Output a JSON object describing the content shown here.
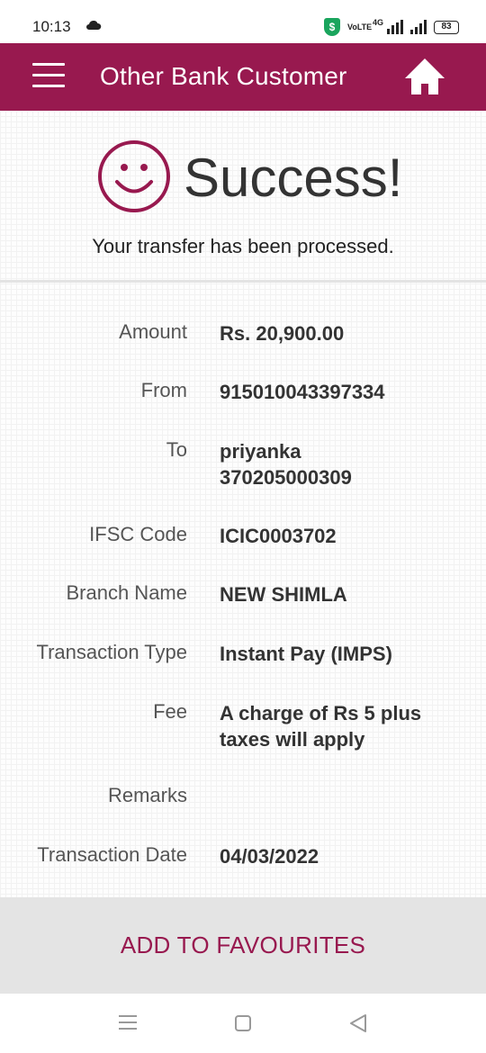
{
  "status_bar": {
    "time": "10:13",
    "volte": "VoLTE",
    "network": "4G",
    "battery": "83"
  },
  "app_bar": {
    "title": "Other Bank Customer",
    "menu_icon": "hamburger-icon",
    "home_icon": "home-icon"
  },
  "success": {
    "title": "Success!",
    "message": "Your transfer has been processed.",
    "icon": "smiley-icon"
  },
  "details": [
    {
      "label": "Amount",
      "value": "Rs. 20,900.00"
    },
    {
      "label": "From",
      "value": "915010043397334"
    },
    {
      "label": "To",
      "value": "priyanka\n370205000309"
    },
    {
      "label": "IFSC Code",
      "value": "ICIC0003702"
    },
    {
      "label": "Branch Name",
      "value": "NEW SHIMLA"
    },
    {
      "label": "Transaction Type",
      "value": "Instant Pay (IMPS)"
    },
    {
      "label": "Fee",
      "value": "A charge of Rs 5 plus taxes will apply"
    },
    {
      "label": "Remarks",
      "value": ""
    },
    {
      "label": "Transaction Date",
      "value": "04/03/2022"
    }
  ],
  "footer": {
    "button_label": "ADD TO FAVOURITES"
  },
  "colors": {
    "brand": "#98194f",
    "footer_bg": "#e4e4e4"
  }
}
